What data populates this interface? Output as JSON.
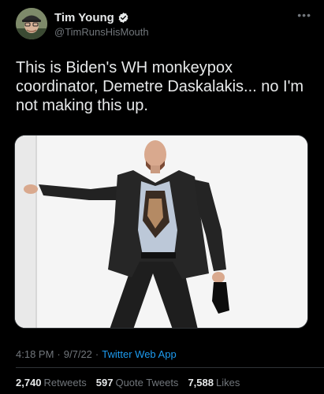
{
  "author": {
    "display_name": "Tim Young",
    "handle": "@TimRunsHisMouth"
  },
  "tweet": {
    "text": "This is Biden's WH monkeypox coordinator, Demetre Daskalakis... no I'm not making this up.",
    "time": "4:18 PM",
    "dot1": "·",
    "date": "9/7/22",
    "dot2": "·",
    "source": "Twitter Web App"
  },
  "stats": {
    "retweets_count": "2,740",
    "retweets_label": "Retweets",
    "quotes_count": "597",
    "quotes_label": "Quote Tweets",
    "likes_count": "7,588",
    "likes_label": "Likes"
  },
  "menu": {
    "more_label": "•••"
  },
  "colors": {
    "background": "#000000",
    "text": "#e7e9ea",
    "muted": "#71767b",
    "accent": "#1d9bf0",
    "divider": "#2f3336"
  },
  "icons": {
    "verified": "verified-badge-icon",
    "more": "more-options-icon"
  }
}
